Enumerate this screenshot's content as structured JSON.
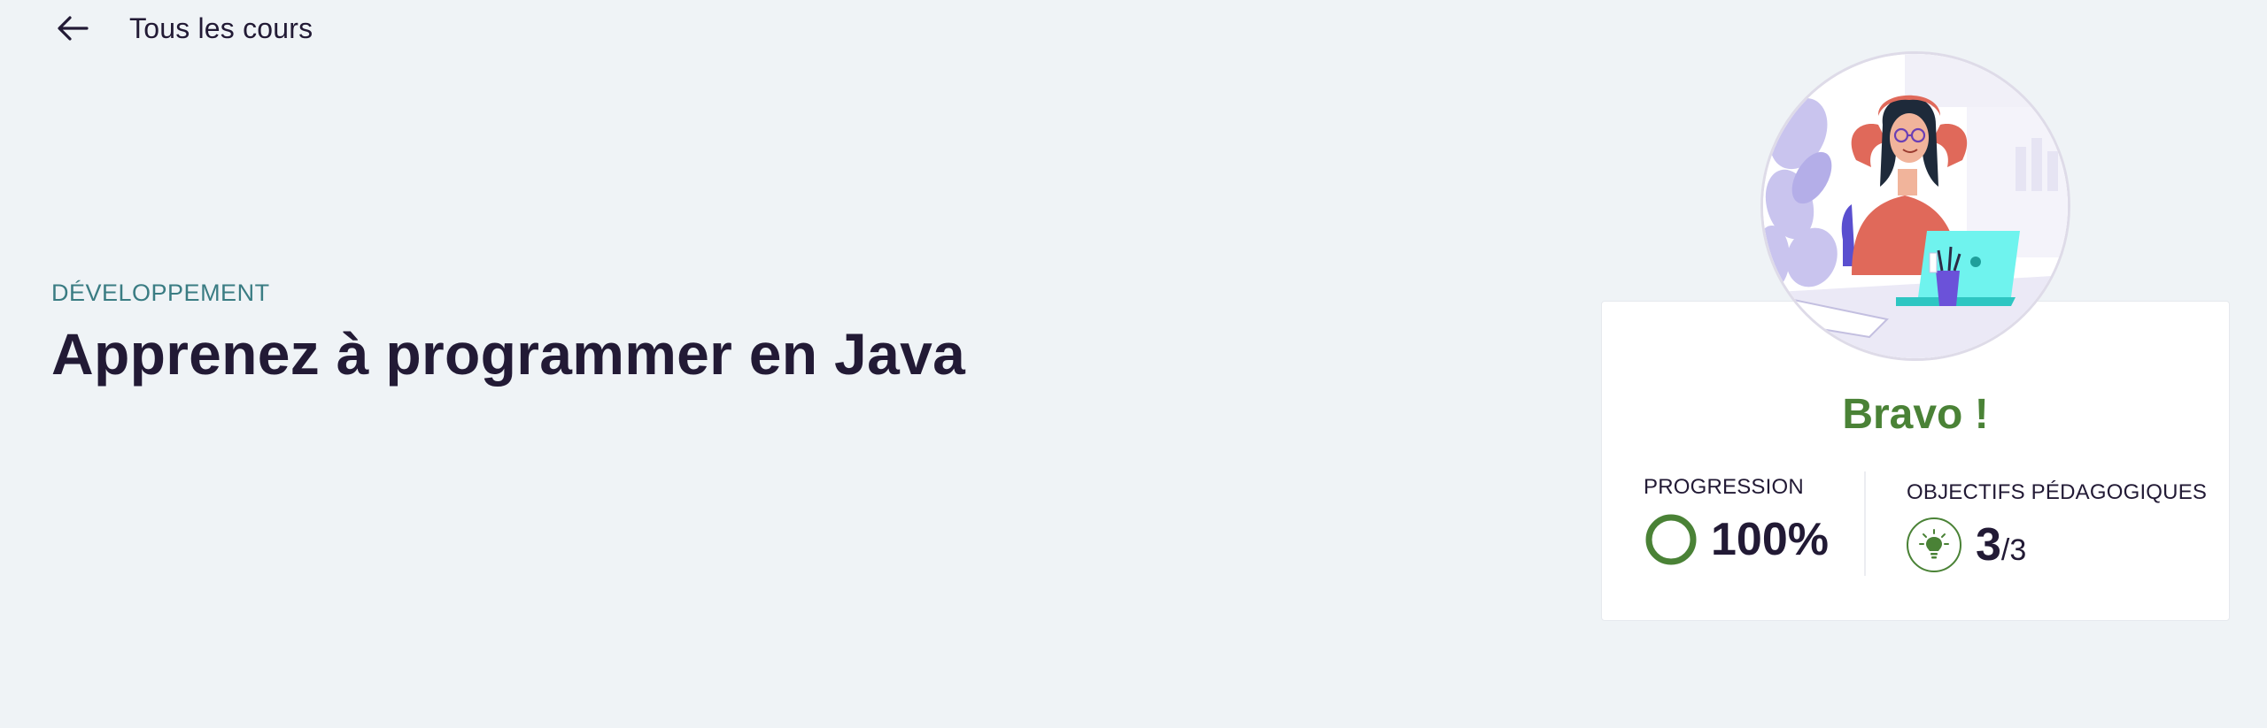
{
  "nav": {
    "back_label": "Tous les cours",
    "back_icon": "arrow-left-icon"
  },
  "course": {
    "category": "DÉVELOPPEMENT",
    "title": "Apprenez à programmer en Java"
  },
  "card": {
    "headline": "Bravo !",
    "progress": {
      "label": "PROGRESSION",
      "value_text": "100%",
      "value": 1.0,
      "icon": "progress-ring-icon"
    },
    "objectives": {
      "label": "OBJECTIFS PÉDAGOGIQUES",
      "done": "3",
      "separator": "/",
      "total": "3",
      "icon": "lightbulb-icon"
    }
  },
  "colors": {
    "background": "#eff3f6",
    "text": "#221a35",
    "category": "#3a7c83",
    "success": "#4a8236",
    "card": "#ffffff"
  }
}
